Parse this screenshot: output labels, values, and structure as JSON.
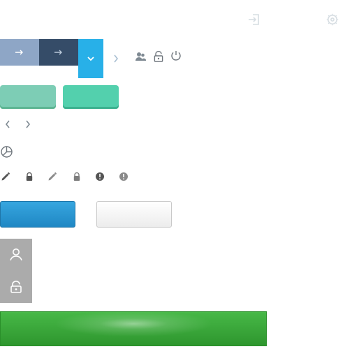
{
  "app": {
    "title": "",
    "description": ""
  },
  "toolbar": {
    "top_right_icons": [
      "login-icon",
      "settings-icon"
    ],
    "action_icons": [
      "users-icon",
      "unlock-icon",
      "power-icon"
    ]
  },
  "controls": {
    "arrow_buttons": [
      {
        "name": "arrow-right-button-1",
        "icon": "arrow-right-icon",
        "bg": "#8ea6c6"
      },
      {
        "name": "arrow-right-button-2",
        "icon": "arrow-right-icon",
        "bg": "#354c68"
      }
    ],
    "dropdown_button": {
      "icon": "chevron-down-icon",
      "bg": "#28b0e8"
    },
    "small_chevron": {
      "icon": "chevron-right-icon"
    },
    "teal_buttons": [
      {
        "bg": "#7dcdb5"
      },
      {
        "bg": "#53d0ad"
      }
    ],
    "nav_buttons": [
      "chevron-left-icon",
      "chevron-right-icon"
    ],
    "pie_icon": "pie-chart-icon",
    "tool_icons": [
      "pencil-icon",
      "lock-icon",
      "pencil-icon",
      "lock-icon",
      "alert-icon",
      "alert-icon"
    ],
    "buttons": {
      "blue": {
        "label": ""
      },
      "white": {
        "label": ""
      }
    },
    "side_panel": {
      "icons": [
        "user-icon",
        "unlock-icon"
      ]
    },
    "green_bar": {
      "label": ""
    }
  },
  "colors": {
    "accent_blue": "#28b0e8",
    "teal_1": "#7dcdb5",
    "teal_2": "#53d0ad",
    "navy": "#354c68",
    "steel_blue": "#8ea6c6",
    "blue_button": "#1f87c4",
    "green_bar": "#2e962e",
    "panel_gray": "#ababab"
  }
}
